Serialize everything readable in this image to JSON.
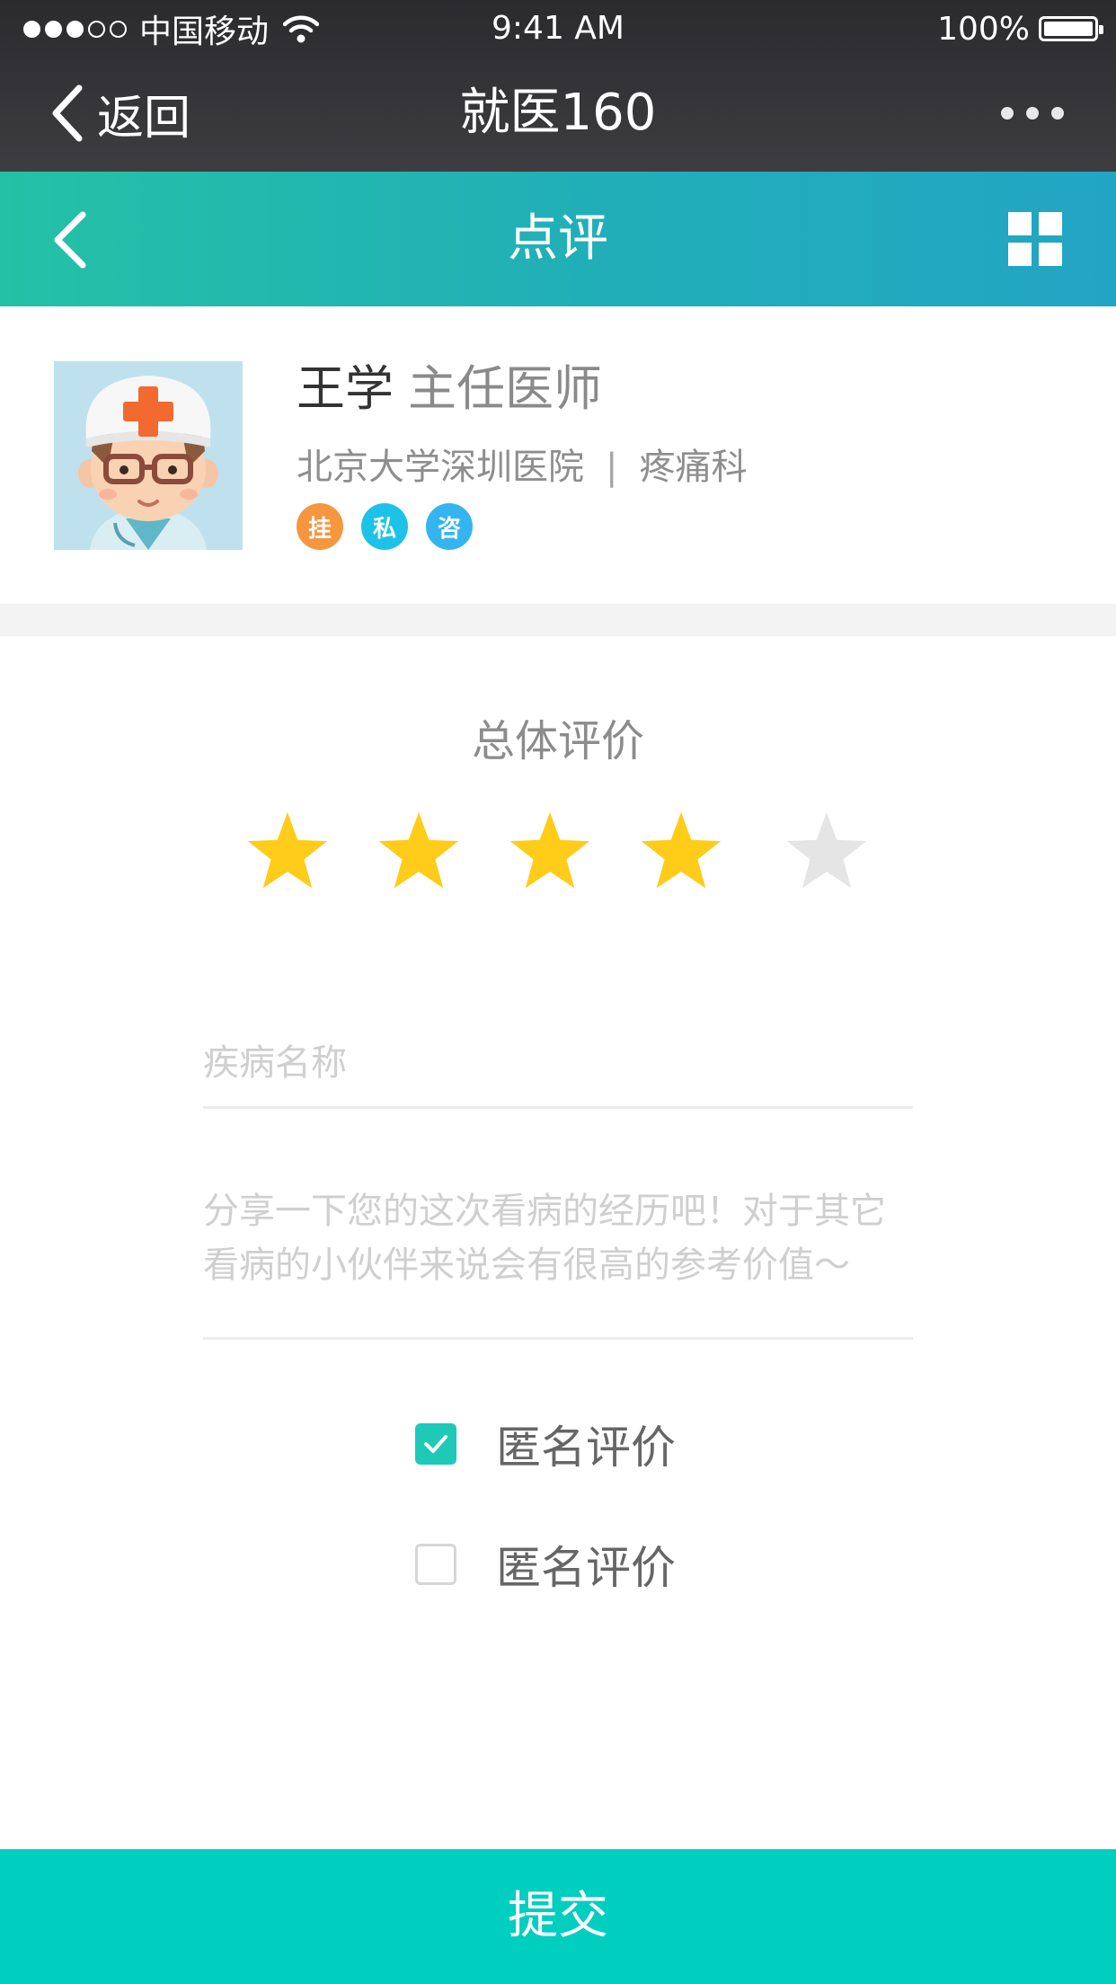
{
  "status_bar": {
    "carrier": "中国移动",
    "time": "9:41 AM",
    "battery": "100%",
    "signal_filled": 3,
    "signal_total": 5
  },
  "nav_bar": {
    "back_label": "返回",
    "title": "就医160",
    "more_icon": "more-dots-icon"
  },
  "header": {
    "title": "点评",
    "back_icon": "chevron-left-icon",
    "menu_icon": "grid-icon",
    "gradient": [
      "#24c1a6",
      "#22a5c4"
    ]
  },
  "doctor": {
    "name": "王学",
    "title": "主任医师",
    "hospital": "北京大学深圳医院",
    "separator": "|",
    "department": "疼痛科",
    "badges": [
      {
        "label": "挂",
        "color": "#f6963f"
      },
      {
        "label": "私",
        "color": "#1dc2e8"
      },
      {
        "label": "咨",
        "color": "#35b5f0"
      }
    ]
  },
  "rating": {
    "label": "总体评价",
    "value": 4,
    "max": 5,
    "active_color": "#ffcc1a",
    "inactive_color": "#e5e5e5"
  },
  "form": {
    "disease_placeholder": "疾病名称",
    "disease_value": "",
    "story_placeholder": "分享一下您的这次看病的经历吧！对于其它看病的小伙伴来说会有很高的参考价值～",
    "story_value": ""
  },
  "options": [
    {
      "label": "匿名评价",
      "checked": true
    },
    {
      "label": "匿名评价",
      "checked": false
    }
  ],
  "submit": {
    "label": "提交",
    "color": "#00cebf"
  }
}
